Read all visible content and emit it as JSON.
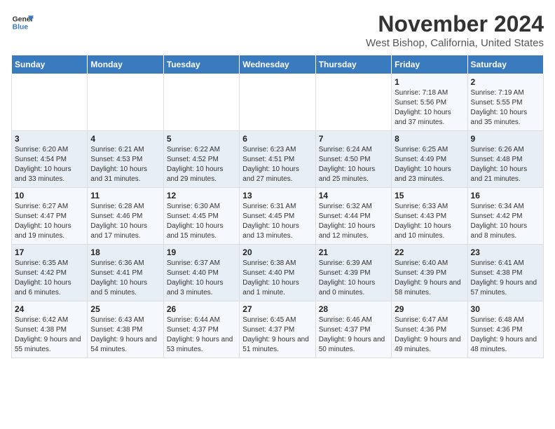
{
  "logo": {
    "line1": "General",
    "line2": "Blue"
  },
  "title": "November 2024",
  "location": "West Bishop, California, United States",
  "days_of_week": [
    "Sunday",
    "Monday",
    "Tuesday",
    "Wednesday",
    "Thursday",
    "Friday",
    "Saturday"
  ],
  "weeks": [
    [
      {
        "day": "",
        "info": ""
      },
      {
        "day": "",
        "info": ""
      },
      {
        "day": "",
        "info": ""
      },
      {
        "day": "",
        "info": ""
      },
      {
        "day": "",
        "info": ""
      },
      {
        "day": "1",
        "info": "Sunrise: 7:18 AM\nSunset: 5:56 PM\nDaylight: 10 hours and 37 minutes."
      },
      {
        "day": "2",
        "info": "Sunrise: 7:19 AM\nSunset: 5:55 PM\nDaylight: 10 hours and 35 minutes."
      }
    ],
    [
      {
        "day": "3",
        "info": "Sunrise: 6:20 AM\nSunset: 4:54 PM\nDaylight: 10 hours and 33 minutes."
      },
      {
        "day": "4",
        "info": "Sunrise: 6:21 AM\nSunset: 4:53 PM\nDaylight: 10 hours and 31 minutes."
      },
      {
        "day": "5",
        "info": "Sunrise: 6:22 AM\nSunset: 4:52 PM\nDaylight: 10 hours and 29 minutes."
      },
      {
        "day": "6",
        "info": "Sunrise: 6:23 AM\nSunset: 4:51 PM\nDaylight: 10 hours and 27 minutes."
      },
      {
        "day": "7",
        "info": "Sunrise: 6:24 AM\nSunset: 4:50 PM\nDaylight: 10 hours and 25 minutes."
      },
      {
        "day": "8",
        "info": "Sunrise: 6:25 AM\nSunset: 4:49 PM\nDaylight: 10 hours and 23 minutes."
      },
      {
        "day": "9",
        "info": "Sunrise: 6:26 AM\nSunset: 4:48 PM\nDaylight: 10 hours and 21 minutes."
      }
    ],
    [
      {
        "day": "10",
        "info": "Sunrise: 6:27 AM\nSunset: 4:47 PM\nDaylight: 10 hours and 19 minutes."
      },
      {
        "day": "11",
        "info": "Sunrise: 6:28 AM\nSunset: 4:46 PM\nDaylight: 10 hours and 17 minutes."
      },
      {
        "day": "12",
        "info": "Sunrise: 6:30 AM\nSunset: 4:45 PM\nDaylight: 10 hours and 15 minutes."
      },
      {
        "day": "13",
        "info": "Sunrise: 6:31 AM\nSunset: 4:45 PM\nDaylight: 10 hours and 13 minutes."
      },
      {
        "day": "14",
        "info": "Sunrise: 6:32 AM\nSunset: 4:44 PM\nDaylight: 10 hours and 12 minutes."
      },
      {
        "day": "15",
        "info": "Sunrise: 6:33 AM\nSunset: 4:43 PM\nDaylight: 10 hours and 10 minutes."
      },
      {
        "day": "16",
        "info": "Sunrise: 6:34 AM\nSunset: 4:42 PM\nDaylight: 10 hours and 8 minutes."
      }
    ],
    [
      {
        "day": "17",
        "info": "Sunrise: 6:35 AM\nSunset: 4:42 PM\nDaylight: 10 hours and 6 minutes."
      },
      {
        "day": "18",
        "info": "Sunrise: 6:36 AM\nSunset: 4:41 PM\nDaylight: 10 hours and 5 minutes."
      },
      {
        "day": "19",
        "info": "Sunrise: 6:37 AM\nSunset: 4:40 PM\nDaylight: 10 hours and 3 minutes."
      },
      {
        "day": "20",
        "info": "Sunrise: 6:38 AM\nSunset: 4:40 PM\nDaylight: 10 hours and 1 minute."
      },
      {
        "day": "21",
        "info": "Sunrise: 6:39 AM\nSunset: 4:39 PM\nDaylight: 10 hours and 0 minutes."
      },
      {
        "day": "22",
        "info": "Sunrise: 6:40 AM\nSunset: 4:39 PM\nDaylight: 9 hours and 58 minutes."
      },
      {
        "day": "23",
        "info": "Sunrise: 6:41 AM\nSunset: 4:38 PM\nDaylight: 9 hours and 57 minutes."
      }
    ],
    [
      {
        "day": "24",
        "info": "Sunrise: 6:42 AM\nSunset: 4:38 PM\nDaylight: 9 hours and 55 minutes."
      },
      {
        "day": "25",
        "info": "Sunrise: 6:43 AM\nSunset: 4:38 PM\nDaylight: 9 hours and 54 minutes."
      },
      {
        "day": "26",
        "info": "Sunrise: 6:44 AM\nSunset: 4:37 PM\nDaylight: 9 hours and 53 minutes."
      },
      {
        "day": "27",
        "info": "Sunrise: 6:45 AM\nSunset: 4:37 PM\nDaylight: 9 hours and 51 minutes."
      },
      {
        "day": "28",
        "info": "Sunrise: 6:46 AM\nSunset: 4:37 PM\nDaylight: 9 hours and 50 minutes."
      },
      {
        "day": "29",
        "info": "Sunrise: 6:47 AM\nSunset: 4:36 PM\nDaylight: 9 hours and 49 minutes."
      },
      {
        "day": "30",
        "info": "Sunrise: 6:48 AM\nSunset: 4:36 PM\nDaylight: 9 hours and 48 minutes."
      }
    ]
  ]
}
